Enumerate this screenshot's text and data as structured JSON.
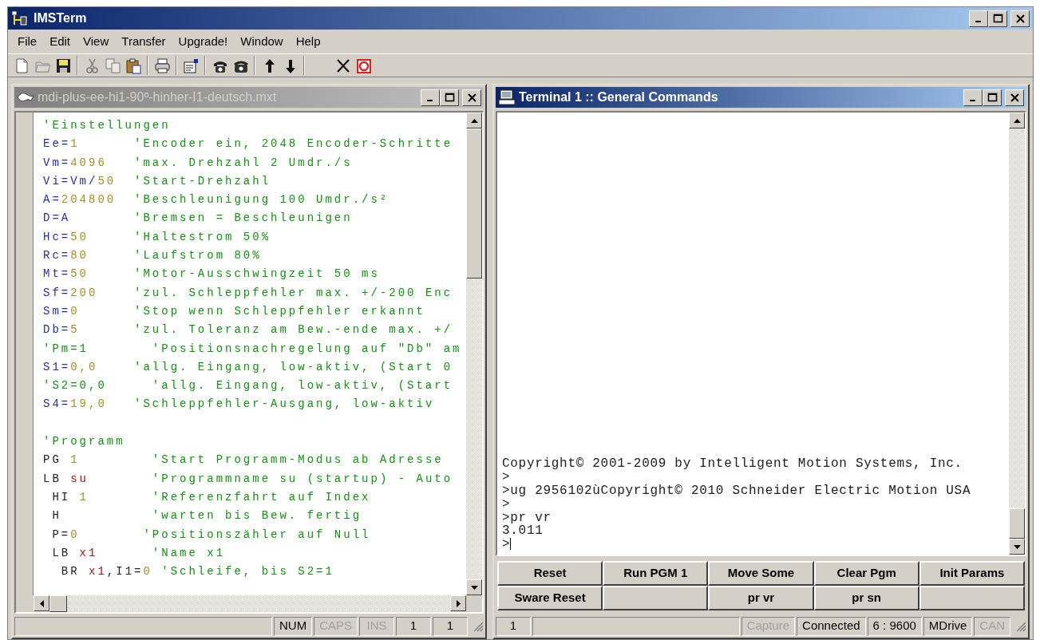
{
  "window": {
    "title": "IMSTerm"
  },
  "menu": [
    "File",
    "Edit",
    "View",
    "Transfer",
    "Upgrade!",
    "Window",
    "Help"
  ],
  "toolbar": [
    {
      "kind": "new",
      "disabled": false
    },
    {
      "kind": "open",
      "disabled": true
    },
    {
      "kind": "save",
      "disabled": false
    },
    {
      "kind": "separator"
    },
    {
      "kind": "cut",
      "disabled": true
    },
    {
      "kind": "copy",
      "disabled": true
    },
    {
      "kind": "paste",
      "disabled": false
    },
    {
      "kind": "separator"
    },
    {
      "kind": "print",
      "disabled": false
    },
    {
      "kind": "separator"
    },
    {
      "kind": "properties",
      "disabled": false
    },
    {
      "kind": "separator"
    },
    {
      "kind": "connect",
      "disabled": false
    },
    {
      "kind": "disconnect",
      "disabled": false
    },
    {
      "kind": "separator"
    },
    {
      "kind": "upload",
      "disabled": false
    },
    {
      "kind": "download",
      "disabled": false
    },
    {
      "kind": "separator"
    },
    {
      "kind": "cancel",
      "disabled": false
    },
    {
      "kind": "stop",
      "disabled": false
    }
  ],
  "editor": {
    "title": "mdi-plus-ee-hi1-90º-hinher-I1-deutsch.mxt",
    "active": false,
    "code_blocks": [
      [
        {
          "tokens": [
            {
              "kind": "comment",
              "text": "'Einstellungen"
            }
          ]
        },
        {
          "tokens": [
            {
              "kind": "command",
              "text": "Ee="
            },
            {
              "kind": "number",
              "text": "1"
            },
            {
              "kind": "comment",
              "text": "      'Encoder ein, 2048 Encoder-Schritte"
            }
          ]
        },
        {
          "tokens": [
            {
              "kind": "command",
              "text": "Vm="
            },
            {
              "kind": "number",
              "text": "4096"
            },
            {
              "kind": "comment",
              "text": "   'max. Drehzahl 2 Umdr./s"
            }
          ]
        },
        {
          "tokens": [
            {
              "kind": "command",
              "text": "Vi=Vm/"
            },
            {
              "kind": "number",
              "text": "50"
            },
            {
              "kind": "comment",
              "text": "  'Start-Drehzahl"
            }
          ]
        },
        {
          "tokens": [
            {
              "kind": "command",
              "text": "A="
            },
            {
              "kind": "number",
              "text": "204800"
            },
            {
              "kind": "comment",
              "text": "  'Beschleunigung 100 Umdr./s²"
            }
          ]
        },
        {
          "tokens": [
            {
              "kind": "command",
              "text": "D=A"
            },
            {
              "kind": "comment",
              "text": "       'Bremsen = Beschleunigen"
            }
          ]
        },
        {
          "tokens": [
            {
              "kind": "command",
              "text": "Hc="
            },
            {
              "kind": "number",
              "text": "50"
            },
            {
              "kind": "comment",
              "text": "     'Haltestrom 50%"
            }
          ]
        },
        {
          "tokens": [
            {
              "kind": "command",
              "text": "Rc="
            },
            {
              "kind": "number",
              "text": "80"
            },
            {
              "kind": "comment",
              "text": "     'Laufstrom 80%"
            }
          ]
        },
        {
          "tokens": [
            {
              "kind": "command",
              "text": "Mt="
            },
            {
              "kind": "number",
              "text": "50"
            },
            {
              "kind": "comment",
              "text": "     'Motor-Ausschwingzeit 50 ms"
            }
          ]
        },
        {
          "tokens": [
            {
              "kind": "command",
              "text": "Sf="
            },
            {
              "kind": "number",
              "text": "200"
            },
            {
              "kind": "comment",
              "text": "    'zul. Schleppfehler max. +/-200 Enc"
            }
          ]
        },
        {
          "tokens": [
            {
              "kind": "command",
              "text": "Sm="
            },
            {
              "kind": "number",
              "text": "0"
            },
            {
              "kind": "comment",
              "text": "      'Stop wenn Schleppfehler erkannt"
            }
          ]
        },
        {
          "tokens": [
            {
              "kind": "command",
              "text": "Db="
            },
            {
              "kind": "number",
              "text": "5"
            },
            {
              "kind": "comment",
              "text": "      'zul. Toleranz am Bew.-ende max. +/"
            }
          ]
        },
        {
          "tokens": [
            {
              "kind": "comment",
              "text": "'Pm=1       'Positionsnachregelung auf \"Db\" am"
            }
          ]
        },
        {
          "tokens": [
            {
              "kind": "command",
              "text": "S1="
            },
            {
              "kind": "number",
              "text": "0,0"
            },
            {
              "kind": "comment",
              "text": "    'allg. Eingang, low-aktiv, (Start 0"
            }
          ]
        },
        {
          "tokens": [
            {
              "kind": "comment",
              "text": "'S2=0,0     'allg. Eingang, low-aktiv, (Start"
            }
          ]
        },
        {
          "tokens": [
            {
              "kind": "command",
              "text": "S4="
            },
            {
              "kind": "number",
              "text": "19,0"
            },
            {
              "kind": "comment",
              "text": "   'Schleppfehler-Ausgang, low-aktiv"
            }
          ]
        }
      ],
      [
        {
          "tokens": [
            {
              "kind": "comment",
              "text": "'Programm"
            }
          ]
        },
        {
          "tokens": [
            {
              "kind": "plain",
              "text": "PG "
            },
            {
              "kind": "number",
              "text": "1"
            },
            {
              "kind": "comment",
              "text": "        'Start Programm-Modus ab Adresse"
            }
          ]
        },
        {
          "tokens": [
            {
              "kind": "plain",
              "text": "LB "
            },
            {
              "kind": "label",
              "text": "su"
            },
            {
              "kind": "comment",
              "text": "       'Programmname su (startup) - Auto"
            }
          ]
        },
        {
          "tokens": [
            {
              "kind": "plain",
              "text": " HI "
            },
            {
              "kind": "number",
              "text": "1"
            },
            {
              "kind": "comment",
              "text": "       'Referenzfahrt auf Index"
            }
          ]
        },
        {
          "tokens": [
            {
              "kind": "plain",
              "text": " H"
            },
            {
              "kind": "comment",
              "text": "          'warten bis Bew. fertig"
            }
          ]
        },
        {
          "tokens": [
            {
              "kind": "plain",
              "text": " P="
            },
            {
              "kind": "number",
              "text": "0"
            },
            {
              "kind": "comment",
              "text": "       'Positionszähler auf Null"
            }
          ]
        },
        {
          "tokens": [
            {
              "kind": "plain",
              "text": " LB "
            },
            {
              "kind": "label",
              "text": "x1"
            },
            {
              "kind": "comment",
              "text": "      'Name x1"
            }
          ]
        },
        {
          "tokens": [
            {
              "kind": "plain",
              "text": "  BR "
            },
            {
              "kind": "label",
              "text": "x1"
            },
            {
              "kind": "plain",
              "text": ",I1="
            },
            {
              "kind": "number",
              "text": "0"
            },
            {
              "kind": "comment",
              "text": " 'Schleife, bis S2=1"
            }
          ]
        }
      ]
    ],
    "status_bar": [
      {
        "kind": "spacer"
      },
      {
        "kind": "text",
        "text": "NUM",
        "disabled": false
      },
      {
        "kind": "text",
        "text": "CAPS",
        "disabled": true
      },
      {
        "kind": "text",
        "text": "INS",
        "disabled": true
      },
      {
        "kind": "text",
        "text": "1",
        "disabled": false
      },
      {
        "kind": "text",
        "text": "1",
        "disabled": false
      }
    ]
  },
  "terminal": {
    "title": "Terminal 1 :: General Commands",
    "active": true,
    "cursor": true,
    "lines": [
      "Copyright© 2001-2009 by Intelligent Motion Systems, Inc.",
      ">",
      ">ug 2956102ùCopyright© 2010 Schneider Electric Motion USA",
      ">",
      ">pr vr",
      "3.011",
      ">"
    ],
    "buttons": [
      {
        "kind": "macro",
        "label": "Reset"
      },
      {
        "kind": "macro",
        "label": "Run PGM 1"
      },
      {
        "kind": "macro",
        "label": "Move Some"
      },
      {
        "kind": "macro",
        "label": "Clear Pgm"
      },
      {
        "kind": "macro",
        "label": "Init Params"
      },
      {
        "kind": "macro",
        "label": "Sware Reset"
      },
      {
        "kind": "empty"
      },
      {
        "kind": "macro",
        "label": "pr vr"
      },
      {
        "kind": "macro",
        "label": "pr sn"
      },
      {
        "kind": "empty"
      }
    ],
    "status_bar": [
      {
        "kind": "text",
        "text": "1",
        "disabled": false
      },
      {
        "kind": "spacer"
      },
      {
        "kind": "text",
        "text": "Capture",
        "disabled": true
      },
      {
        "kind": "text",
        "text": "Connected",
        "disabled": false
      },
      {
        "kind": "text",
        "text": "6 : 9600",
        "disabled": false
      },
      {
        "kind": "text",
        "text": "MDrive",
        "disabled": false
      },
      {
        "kind": "text",
        "text": "CAN",
        "disabled": true
      }
    ]
  }
}
